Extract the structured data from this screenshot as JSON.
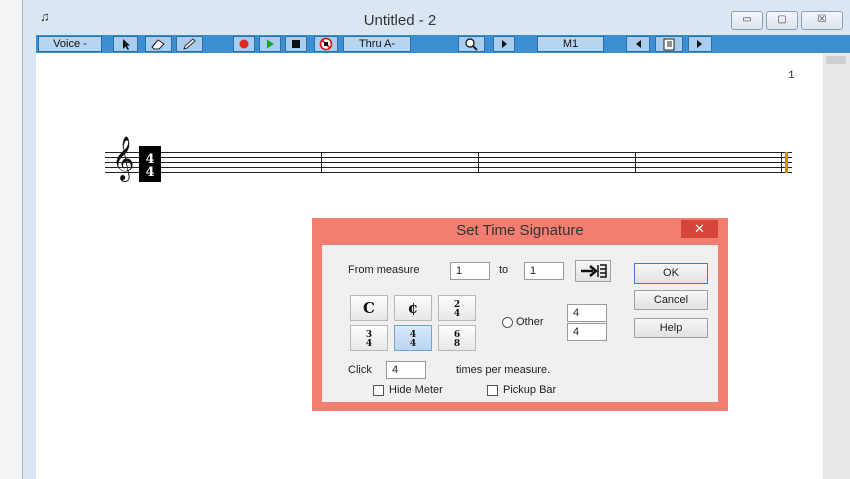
{
  "window": {
    "title": "Untitled - 2",
    "controls": {
      "minimize": "▭",
      "maximize": "▢",
      "close": "☒"
    }
  },
  "toolbar": {
    "voice_label": "Voice -",
    "thru_label": "Thru A-",
    "measure_label": "M1"
  },
  "score": {
    "page_number": "1"
  },
  "dialog": {
    "title": "Set Time Signature",
    "close": "✕",
    "from_measure_label": "From measure",
    "from_value": "1",
    "to_label": "to",
    "to_value": "1",
    "ok": "OK",
    "cancel": "Cancel",
    "help": "Help",
    "time_sigs": [
      {
        "top": "C"
      },
      {
        "top": "¢"
      },
      {
        "top": "2",
        "bottom": "4"
      },
      {
        "top": "3",
        "bottom": "4"
      },
      {
        "top": "4",
        "bottom": "4"
      },
      {
        "top": "6",
        "bottom": "8"
      }
    ],
    "other_label": "Other",
    "other_top": "4",
    "other_bottom": "4",
    "click_label": "Click",
    "click_value": "4",
    "times_label": "times per measure.",
    "hide_meter": "Hide Meter",
    "pickup_bar": "Pickup Bar"
  }
}
